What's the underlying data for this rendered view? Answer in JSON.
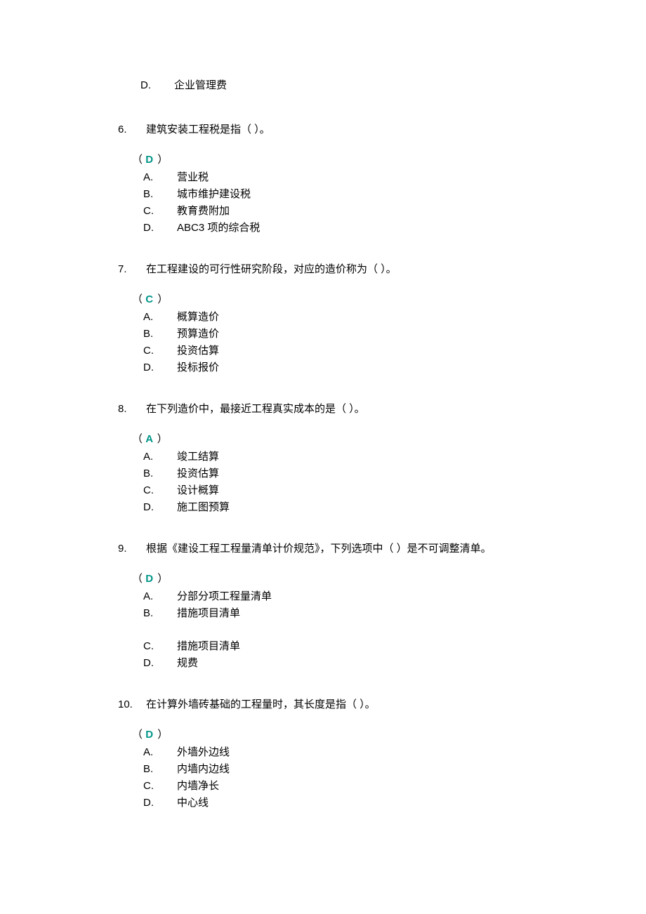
{
  "orphan": {
    "letter": "D.",
    "text": "企业管理费"
  },
  "questions": [
    {
      "num": "6.",
      "text": "建筑安装工程税是指（ ）。",
      "answer_open": "（",
      "answer_letter": "D",
      "answer_close": "）",
      "options": [
        {
          "letter": "A.",
          "text": "营业税"
        },
        {
          "letter": "B.",
          "text": "城市维护建设税"
        },
        {
          "letter": "C.",
          "text": "教育费附加"
        },
        {
          "letter": "D.",
          "text": "ABC3 项的综合税"
        }
      ]
    },
    {
      "num": "7.",
      "text": "在工程建设的可行性研究阶段，对应的造价称为（ ）。",
      "answer_open": "（",
      "answer_letter": "C",
      "answer_close": "）",
      "options": [
        {
          "letter": "A.",
          "text": "概算造价"
        },
        {
          "letter": "B.",
          "text": "预算造价"
        },
        {
          "letter": "C.",
          "text": "投资估算"
        },
        {
          "letter": "D.",
          "text": "投标报价"
        }
      ]
    },
    {
      "num": "8.",
      "text": "在下列造价中，最接近工程真实成本的是（ ）。",
      "answer_open": "（",
      "answer_letter": "A",
      "answer_close": "）",
      "options": [
        {
          "letter": "A.",
          "text": "竣工结算"
        },
        {
          "letter": "B.",
          "text": "投资估算"
        },
        {
          "letter": "C.",
          "text": "设计概算"
        },
        {
          "letter": "D.",
          "text": "施工图预算"
        }
      ]
    },
    {
      "num": "9.",
      "text": "根据《建设工程工程量清单计价规范》，下列选项中（ ）是不可调整清单。",
      "answer_open": "（",
      "answer_letter": "D",
      "answer_close": "）",
      "options": [
        {
          "letter": "A.",
          "text": "分部分项工程量清单"
        },
        {
          "letter": "B.",
          "text": "措施项目清单",
          "gap_after": true
        },
        {
          "letter": "C.",
          "text": "措施项目清单"
        },
        {
          "letter": "D.",
          "text": "规费"
        }
      ]
    },
    {
      "num": "10.",
      "text": "在计算外墙砖基础的工程量时，其长度是指（ ）。",
      "answer_open": "（",
      "answer_letter": "D",
      "answer_close": "）",
      "options": [
        {
          "letter": "A.",
          "text": "外墙外边线"
        },
        {
          "letter": "B.",
          "text": "内墙内边线"
        },
        {
          "letter": "C.",
          "text": "内墙净长"
        },
        {
          "letter": "D.",
          "text": "中心线"
        }
      ]
    }
  ]
}
